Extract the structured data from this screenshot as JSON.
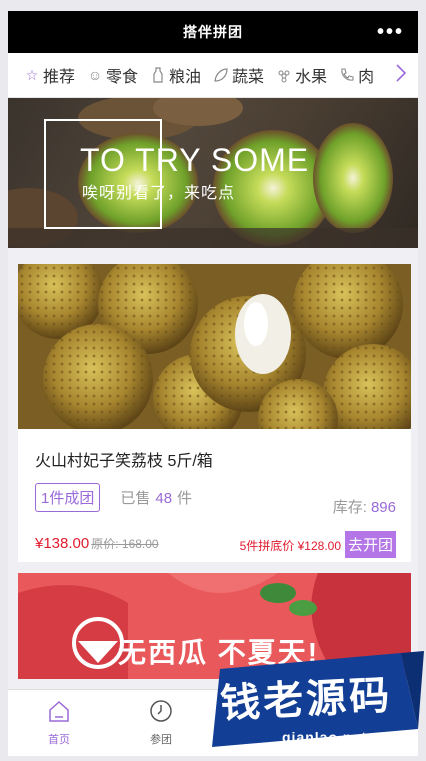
{
  "header": {
    "title": "搭伴拼团",
    "more_label": "•••"
  },
  "categories": [
    {
      "label": "推荐",
      "icon": "star-icon"
    },
    {
      "label": "零食",
      "icon": "smile-icon"
    },
    {
      "label": "粮油",
      "icon": "bottle-icon"
    },
    {
      "label": "蔬菜",
      "icon": "leaf-icon"
    },
    {
      "label": "水果",
      "icon": "grape-icon"
    },
    {
      "label": "肉",
      "icon": "phone-icon"
    }
  ],
  "banner": {
    "headline": "TO TRY SOME",
    "subline": "唉呀别看了，来吃点"
  },
  "products": [
    {
      "name": "火山村妃子笑荔枝 5斤/箱",
      "tag": "1件成团",
      "sold_label": "已售",
      "sold_count": "48",
      "sold_unit": "件",
      "stock_label": "库存:",
      "stock_value": "896",
      "price": "¥138.00",
      "orig_price": "原价: 168.00",
      "lowest_price": "5件拼底价 ¥128.00",
      "button": "去开团"
    }
  ],
  "banner2": {
    "text": "无西瓜 不夏天!"
  },
  "tabs": [
    {
      "label": "首页"
    },
    {
      "label": "参团"
    },
    {
      "label": ""
    },
    {
      "label": ""
    }
  ],
  "watermark": {
    "text": "钱老源码",
    "url": "qianlao.net"
  },
  "colors": {
    "accent": "#9a6ad8",
    "price": "#e21b2f",
    "button": "#b476e6"
  }
}
